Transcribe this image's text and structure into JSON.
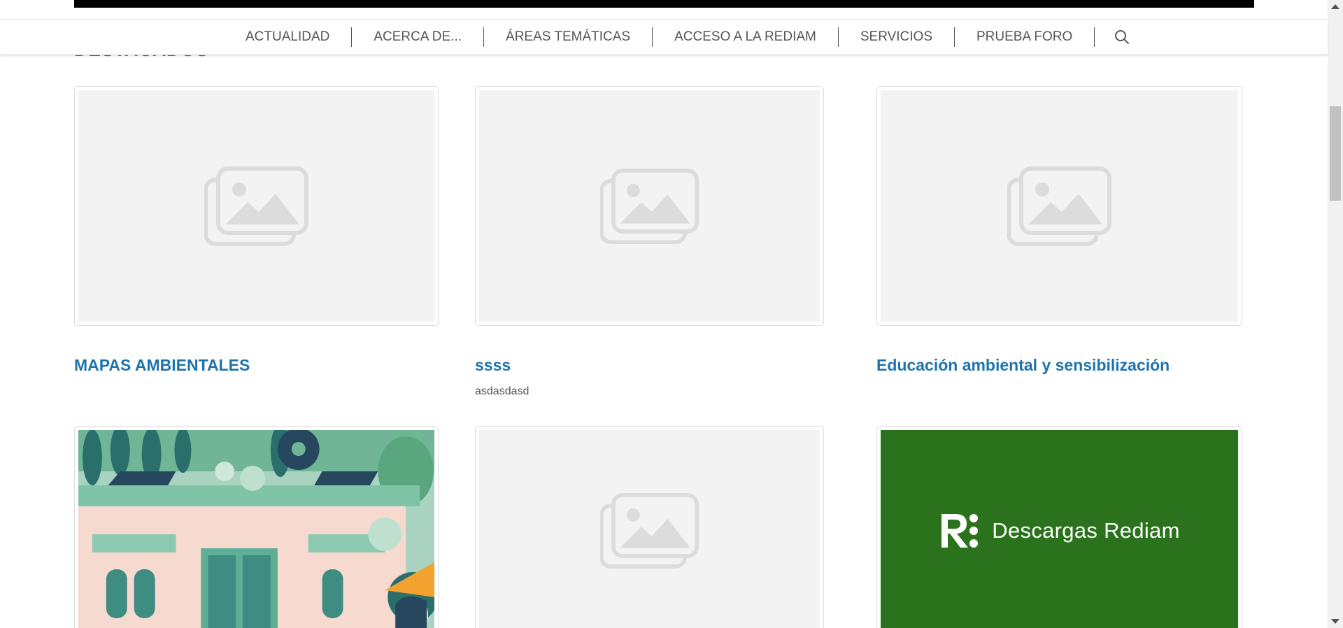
{
  "section": {
    "heading": "DESTACADOS"
  },
  "nav": {
    "items": [
      {
        "label": "ACTUALIDAD"
      },
      {
        "label": "ACERCA DE..."
      },
      {
        "label": "ÁREAS TEMÁTICAS"
      },
      {
        "label": "ACCESO A LA REDIAM"
      },
      {
        "label": "SERVICIOS"
      },
      {
        "label": "PRUEBA FORO"
      }
    ],
    "search_icon": "search-icon"
  },
  "cards": [
    {
      "title": "MAPAS AMBIENTALES",
      "description": "",
      "image": "placeholder-image-icon"
    },
    {
      "title": "ssss",
      "description": "asdasdasd",
      "image": "placeholder-image-icon"
    },
    {
      "title": "Educación ambiental y sensibilización",
      "description": "",
      "image": "placeholder-image-icon"
    },
    {
      "title": "",
      "description": "",
      "image": "illustration-green-house"
    },
    {
      "title": "",
      "description": "",
      "image": "placeholder-image-icon"
    },
    {
      "title": "",
      "description": "",
      "image": "descargas-rediam-banner",
      "banner_text": "Descargas Rediam"
    }
  ],
  "colors": {
    "link": "#1f73ad",
    "banner_green": "#2a721c",
    "placeholder_bg": "#f3f3f3"
  }
}
